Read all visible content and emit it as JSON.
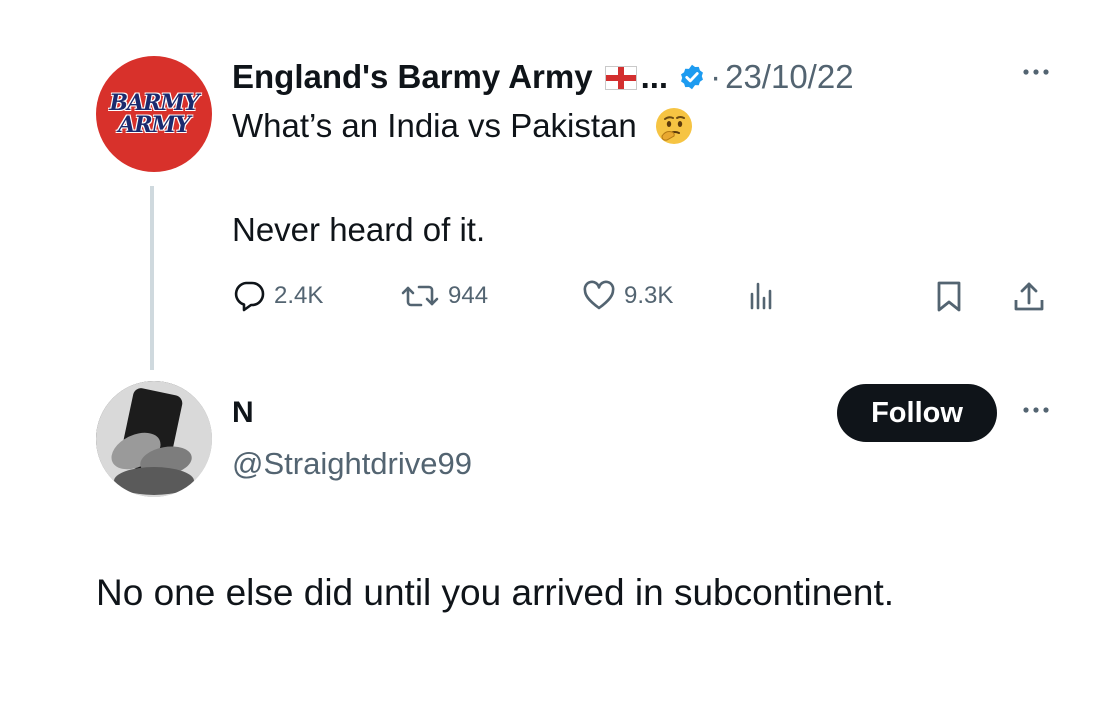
{
  "parent_tweet": {
    "display_name": "England's Barmy Army",
    "ellipsis": "...",
    "date_separator": "·",
    "date": "23/10/22",
    "avatar_text": [
      "BARMY",
      "ARMY"
    ],
    "text_line_1": "What’s an India vs Pakistan",
    "emoji": "thinking-face",
    "text_line_2": "Never heard of it.",
    "actions": {
      "replies": "2.4K",
      "retweets": "944",
      "likes": "9.3K"
    }
  },
  "reply_tweet": {
    "display_name": "N",
    "handle": "@Straightdrive99",
    "follow_label": "Follow",
    "text": "No one else did until you arrived in subcontinent."
  },
  "colors": {
    "text_primary": "#0f1419",
    "text_secondary": "#536471",
    "verified_blue": "#1d9bf0",
    "avatar_red": "#d8312b",
    "thread_line": "#cfd9de"
  },
  "icons": {
    "reply": "speech-bubble-icon",
    "retweet": "retweet-icon",
    "like": "heart-icon",
    "views": "bar-chart-icon",
    "bookmark": "bookmark-icon",
    "share": "share-upload-icon",
    "more": "more-dots-icon",
    "verified": "verified-badge-icon",
    "flag": "england-flag-icon"
  }
}
